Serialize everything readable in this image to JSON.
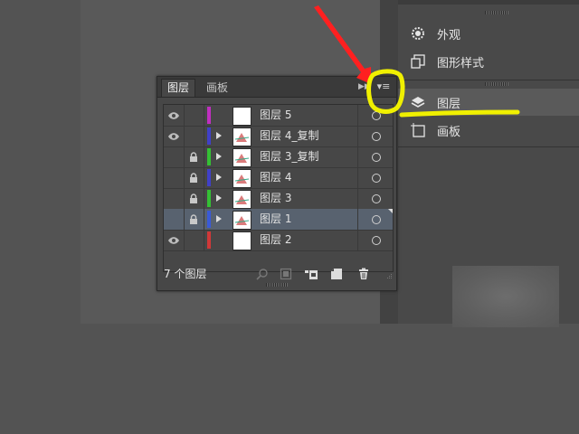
{
  "dock": {
    "items": [
      {
        "label": "外观",
        "icon": "sun-icon"
      },
      {
        "label": "图形样式",
        "icon": "graphic-styles-icon"
      },
      {
        "label": "图层",
        "icon": "layers-icon"
      },
      {
        "label": "画板",
        "icon": "artboard-icon"
      }
    ]
  },
  "panel": {
    "tabs": [
      "图层",
      "画板"
    ],
    "menu_glyph": "▾≡",
    "collapse_glyph": "▶▶",
    "layers": [
      {
        "name": "图层 5",
        "color": "#c02fc0",
        "visible": true,
        "locked": false,
        "expandable": false,
        "selected": false
      },
      {
        "name": "图层 4_复制",
        "color": "#4040c8",
        "visible": true,
        "locked": false,
        "expandable": true,
        "selected": false
      },
      {
        "name": "图层 3_复制",
        "color": "#34c034",
        "visible": false,
        "locked": true,
        "expandable": true,
        "selected": false
      },
      {
        "name": "图层 4",
        "color": "#4040c8",
        "visible": false,
        "locked": true,
        "expandable": true,
        "selected": false
      },
      {
        "name": "图层 3",
        "color": "#34c034",
        "visible": false,
        "locked": true,
        "expandable": true,
        "selected": false
      },
      {
        "name": "图层 1",
        "color": "#3a5ad8",
        "visible": false,
        "locked": true,
        "expandable": true,
        "selected": true
      },
      {
        "name": "图层 2",
        "color": "#d03838",
        "visible": true,
        "locked": false,
        "expandable": false,
        "selected": false
      }
    ],
    "layer_count": "7 个图层"
  },
  "colors": {
    "highlight": "#f0f000",
    "arrow": "#ff2020"
  }
}
